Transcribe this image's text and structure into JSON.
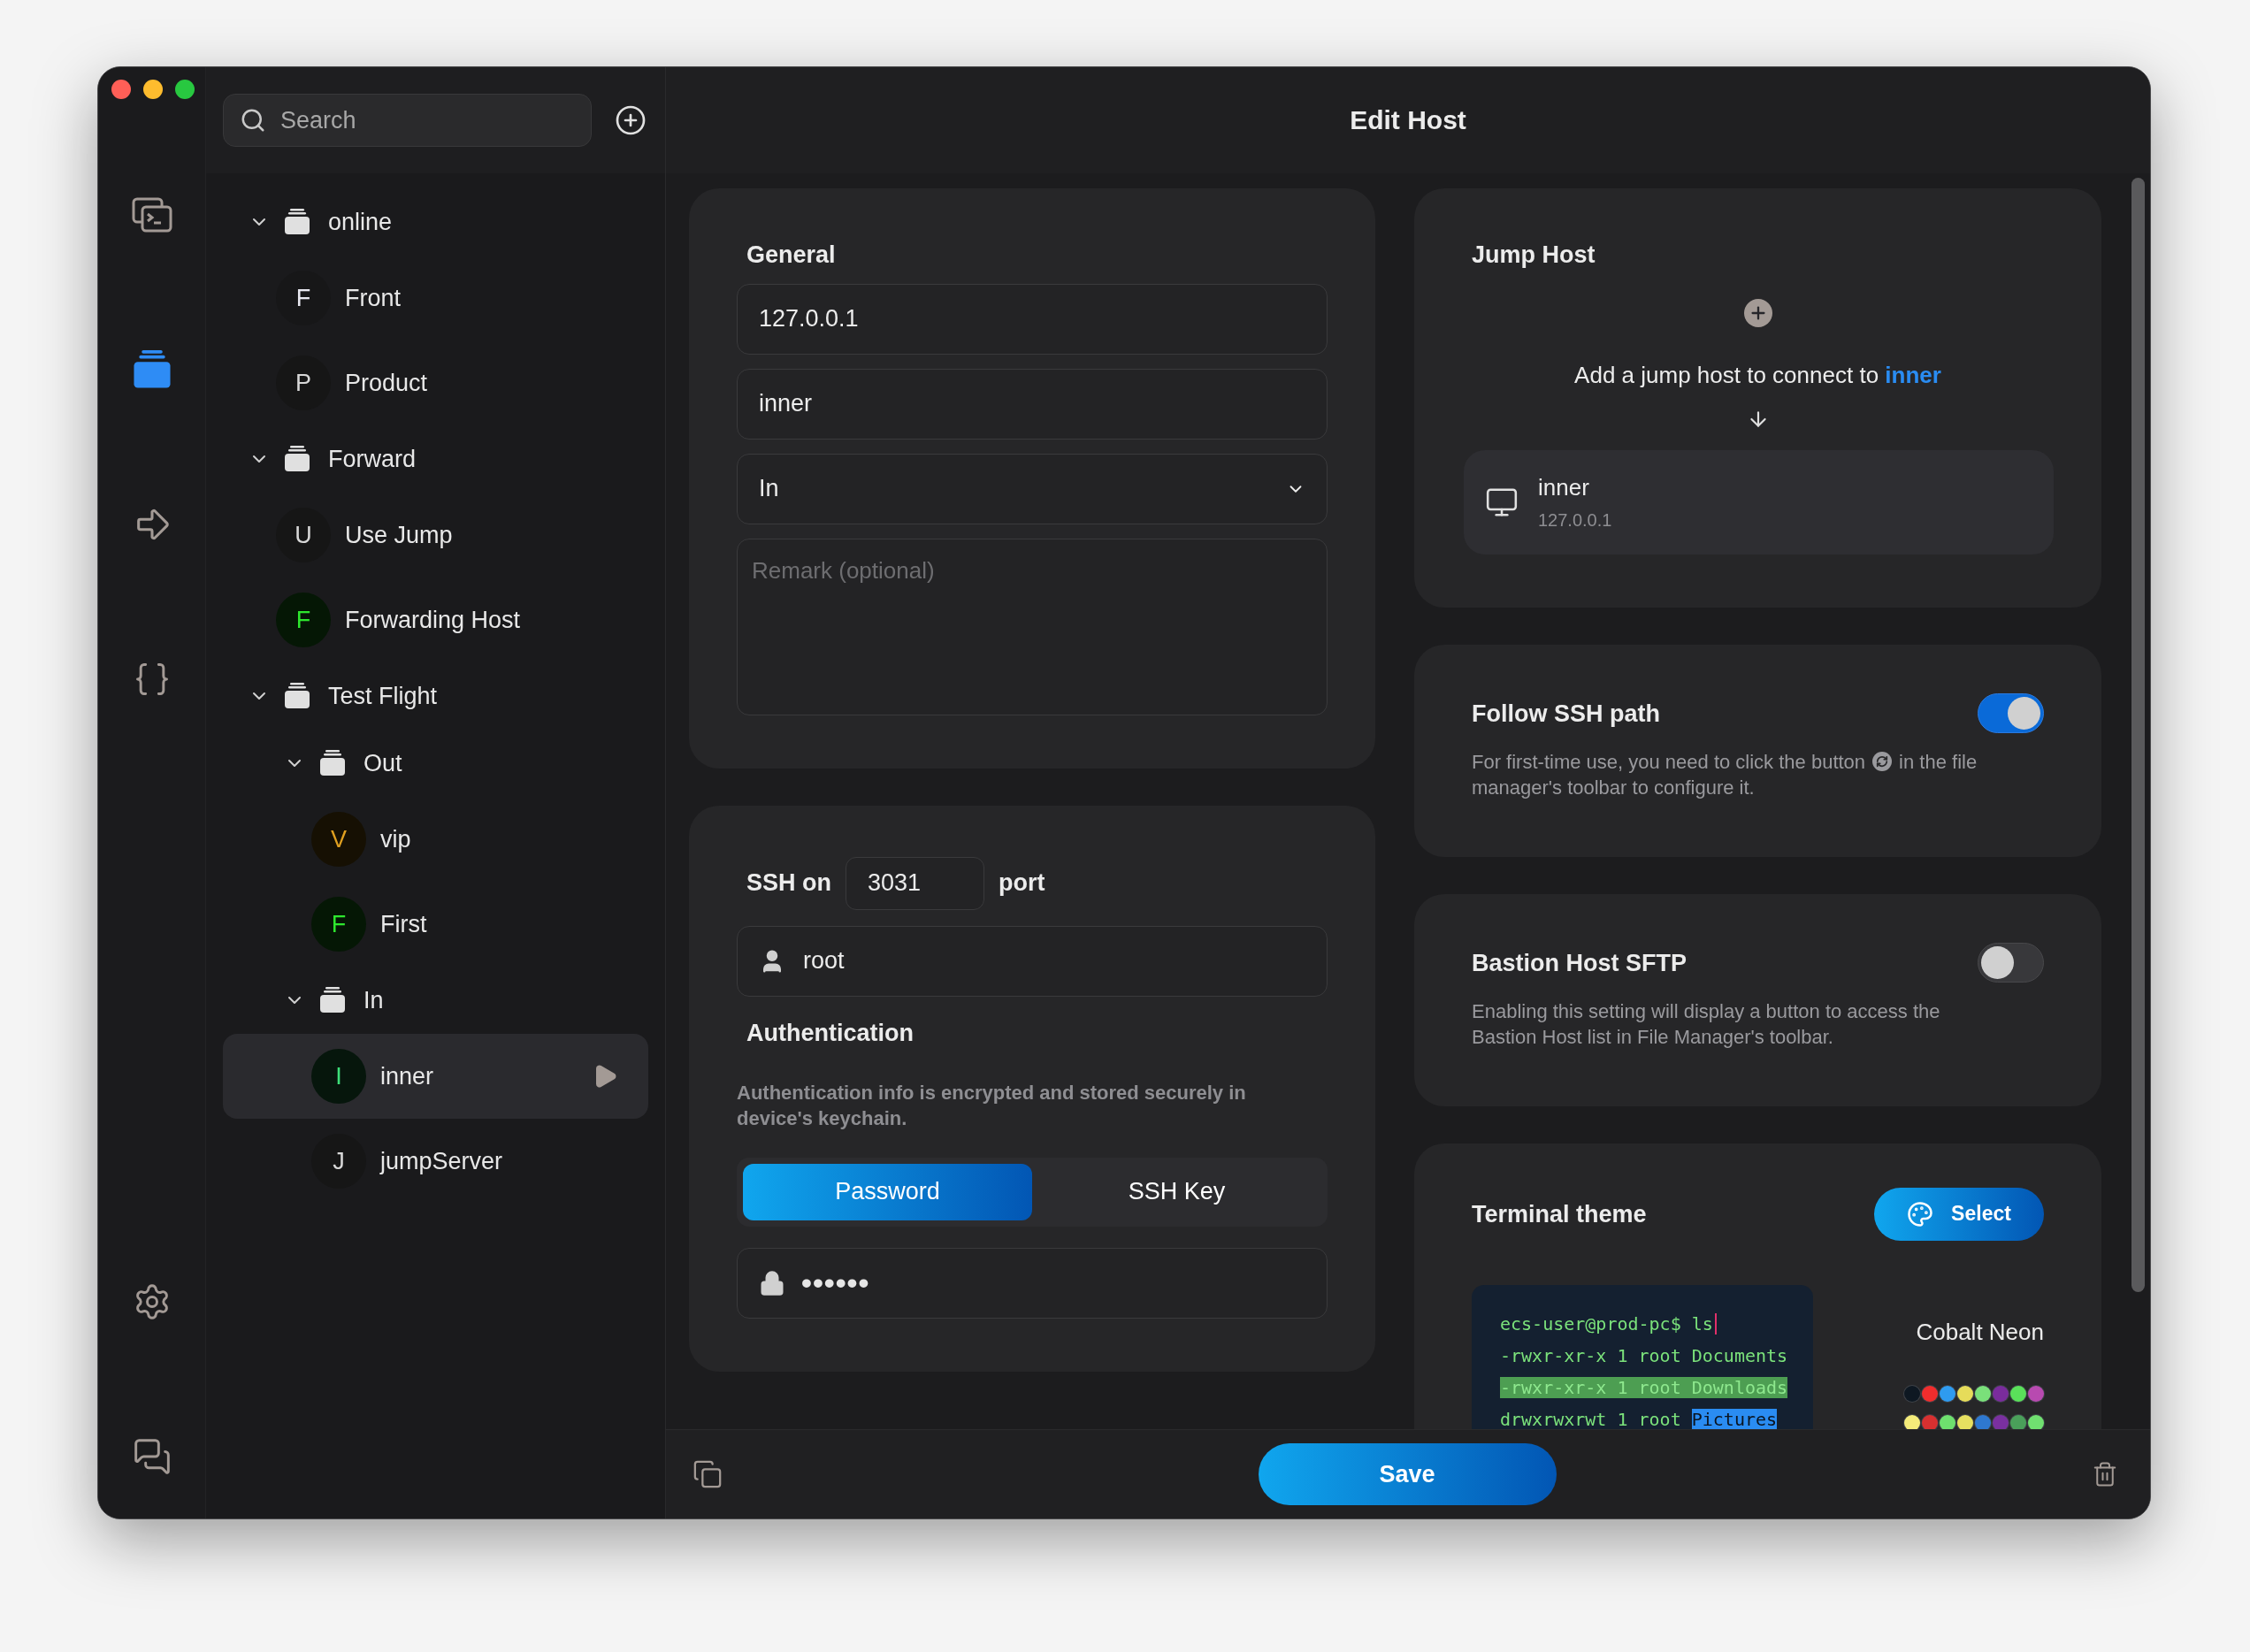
{
  "window": {
    "title": "Edit Host"
  },
  "rail": {
    "top": [
      {
        "kind": "terminals",
        "selected": false
      },
      {
        "kind": "hosts",
        "selected": true
      },
      {
        "kind": "forward",
        "selected": false
      },
      {
        "kind": "snippets",
        "selected": false
      }
    ],
    "bottom": [
      {
        "kind": "settings",
        "selected": false
      },
      {
        "kind": "feedback",
        "selected": false
      }
    ]
  },
  "sidebar": {
    "search": {
      "placeholder": "Search"
    },
    "tree": [
      {
        "kind": "group",
        "label": "online",
        "expanded": true,
        "children": [
          {
            "kind": "host",
            "label": "Front",
            "initial": "F",
            "color": "#e8e8f0",
            "selected": false
          },
          {
            "kind": "host",
            "label": "Product",
            "initial": "P",
            "color": "#d8d8d8",
            "selected": false
          }
        ]
      },
      {
        "kind": "group",
        "label": "Forward",
        "expanded": true,
        "children": [
          {
            "kind": "host",
            "label": "Use Jump",
            "initial": "U",
            "color": "#d8d8d8",
            "selected": false
          },
          {
            "kind": "host",
            "label": "Forwarding Host",
            "initial": "F",
            "color": "#2ee62e",
            "selected": false
          }
        ]
      },
      {
        "kind": "group",
        "label": "Test Flight",
        "expanded": true,
        "children": [
          {
            "kind": "group",
            "label": "Out",
            "expanded": true,
            "children": [
              {
                "kind": "host",
                "label": "vip",
                "initial": "V",
                "color": "#e0a020",
                "selected": false
              },
              {
                "kind": "host",
                "label": "First",
                "initial": "F",
                "color": "#2ee62e",
                "selected": false
              }
            ]
          },
          {
            "kind": "group",
            "label": "In",
            "expanded": true,
            "children": [
              {
                "kind": "host",
                "label": "inner",
                "initial": "I",
                "color": "#3ee07a",
                "selected": true
              },
              {
                "kind": "host",
                "label": "jumpServer",
                "initial": "J",
                "color": "#d8d8d8",
                "selected": false
              }
            ]
          }
        ]
      }
    ]
  },
  "general": {
    "title": "General",
    "fields": [
      {
        "kind": "text",
        "value": "127.0.0.1"
      },
      {
        "kind": "text",
        "value": "inner"
      },
      {
        "kind": "select",
        "value": "In"
      },
      {
        "kind": "textarea",
        "placeholder": "Remark (optional)"
      }
    ]
  },
  "ssh": {
    "label_before": "SSH on",
    "port": "3031",
    "label_after": "port",
    "username": "root",
    "auth_title": "Authentication",
    "auth_note": "Authentication info is encrypted and stored securely in device's keychain.",
    "methods": [
      {
        "label": "Password",
        "selected": true
      },
      {
        "label": "SSH Key",
        "selected": false
      }
    ],
    "password": "••••••"
  },
  "jump_host": {
    "title": "Jump Host",
    "message": "Add a jump host to connect to **inner**",
    "host": {
      "name": "inner",
      "address": "127.0.0.1"
    }
  },
  "toggle_cards": [
    {
      "title": "Follow SSH path",
      "on": true,
      "description": "For first-time use, you need to click the button",
      "description_after_icon": "in the file",
      "description_continued": "manager's toolbar to configure it."
    },
    {
      "title": "Bastion Host SFTP",
      "on": false,
      "description": "Enabling this setting will display a button to access the Bastion Host list in File Manager's toolbar."
    }
  ],
  "terminal_theme": {
    "title": "Terminal theme",
    "button": "Select",
    "theme_name": "Cobalt Neon",
    "preview": [
      {
        "kind": "prompt",
        "segments": [
          {
            "text": "ecs-user@prod-pc$ ls",
            "kind": "plain"
          }
        ]
      },
      {
        "kind": "output",
        "segments": [
          {
            "text": "-rwxr-xr-x 1 root Documents",
            "kind": "plain"
          }
        ]
      },
      {
        "kind": "output",
        "segments": [
          {
            "text": "-rwxr-xr-x 1 root Downloads",
            "kind": "marked"
          }
        ]
      },
      {
        "kind": "output",
        "segments": [
          {
            "text": "drwxrwxrwt 1 root ",
            "kind": "plain"
          },
          {
            "text": "Pictures",
            "kind": "selected"
          }
        ]
      }
    ],
    "palette": [
      [
        {
          "color": "#0e1822"
        },
        {
          "color": "#f02d2d"
        },
        {
          "color": "#2e9bf0"
        },
        {
          "color": "#e6dc5a"
        },
        {
          "color": "#7ae07a"
        },
        {
          "color": "#7a2c9c"
        },
        {
          "color": "#5ae05a"
        },
        {
          "color": "#b84ab0"
        }
      ],
      [
        {
          "color": "#f5ec7a"
        },
        {
          "color": "#d83030"
        },
        {
          "color": "#6ee06e"
        },
        {
          "color": "#e6e060"
        },
        {
          "color": "#2e78d0"
        },
        {
          "color": "#7a30a0"
        },
        {
          "color": "#4aa05a"
        },
        {
          "color": "#70e070"
        }
      ]
    ]
  },
  "footer": {
    "save": "Save"
  }
}
